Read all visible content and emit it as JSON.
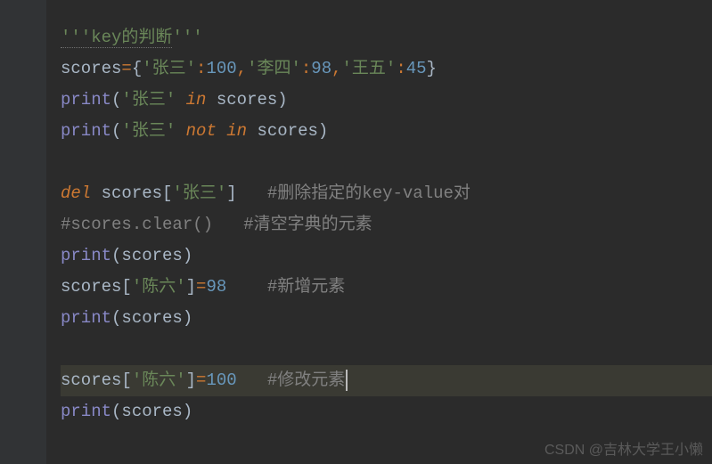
{
  "code": {
    "line1": {
      "docstring_open": "'''",
      "docstring_text": "key的判断",
      "docstring_close": "'''"
    },
    "line2": {
      "var": "scores",
      "eq": "=",
      "brace_l": "{",
      "k1": "'张三'",
      "colon1": ":",
      "v1": "100",
      "comma1": ",",
      "k2": "'李四'",
      "colon2": ":",
      "v2": "98",
      "comma2": ",",
      "k3": "'王五'",
      "colon3": ":",
      "v3": "45",
      "brace_r": "}"
    },
    "line3": {
      "print": "print",
      "paren_l": "(",
      "str": "'张三'",
      "sp": " ",
      "in": "in",
      "sp2": " ",
      "var": "scores",
      "paren_r": ")"
    },
    "line4": {
      "print": "print",
      "paren_l": "(",
      "str": "'张三'",
      "sp": " ",
      "not": "not",
      "sp2": " ",
      "in": "in",
      "sp3": " ",
      "var": "scores",
      "paren_r": ")"
    },
    "line6": {
      "del": "del",
      "sp": " ",
      "var": "scores",
      "bracket_l": "[",
      "str": "'张三'",
      "bracket_r": "]",
      "gap": "   ",
      "comment": "#删除指定的key-value对"
    },
    "line7": {
      "comment": "#scores.clear()   #清空字典的元素"
    },
    "line8": {
      "print": "print",
      "paren_l": "(",
      "var": "scores",
      "paren_r": ")"
    },
    "line9": {
      "var": "scores",
      "bracket_l": "[",
      "str": "'陈六'",
      "bracket_r": "]",
      "eq": "=",
      "num": "98",
      "gap": "    ",
      "comment": "#新增元素"
    },
    "line10": {
      "print": "print",
      "paren_l": "(",
      "var": "scores",
      "paren_r": ")"
    },
    "line12": {
      "var": "scores",
      "bracket_l": "[",
      "str": "'陈六'",
      "bracket_r": "]",
      "eq": "=",
      "num": "100",
      "gap": "   ",
      "comment": "#修改元素"
    },
    "line13": {
      "print": "print",
      "paren_l": "(",
      "var": "scores",
      "paren_r": ")"
    }
  },
  "watermark": "CSDN @吉林大学王小懒"
}
